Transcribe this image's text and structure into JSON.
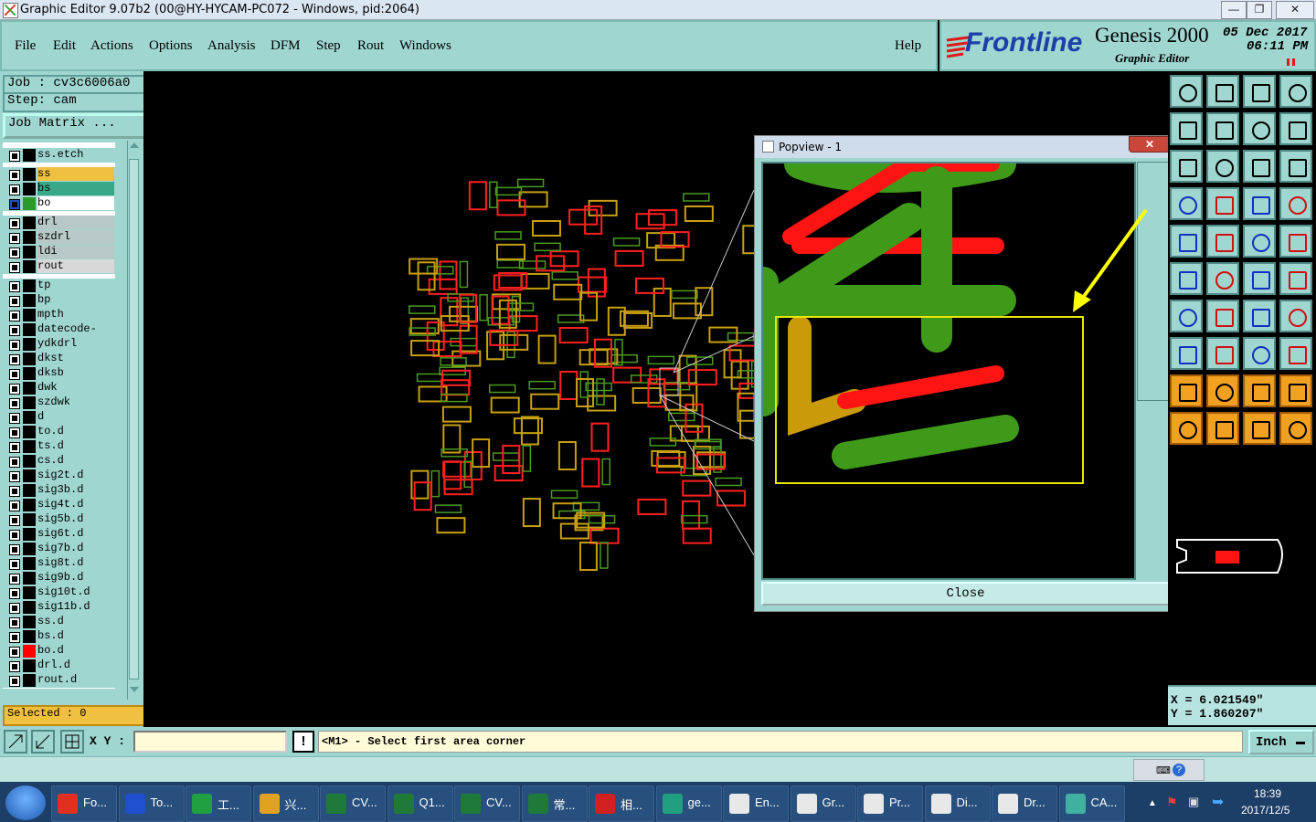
{
  "window": {
    "title": "Graphic Editor 9.07b2 (00@HY-HYCAM-PC072 - Windows, pid:2064)"
  },
  "menu": [
    "File",
    "Edit",
    "Actions",
    "Options",
    "Analysis",
    "DFM",
    "Step",
    "Rout",
    "Windows"
  ],
  "help": "Help",
  "brand": {
    "logo": "Frontline",
    "product": "Genesis 2000",
    "subtitle": "Graphic Editor",
    "date": "05 Dec 2017",
    "time": "06:11 PM"
  },
  "job": {
    "job_label": "Job : cv3c6006a0",
    "step_label": "Step: cam",
    "matrix_button": "Job Matrix ..."
  },
  "layers": [
    {
      "name": "ss.etch",
      "color": "#000000",
      "sep": false
    },
    {
      "name": "ss",
      "color": "#000000",
      "bg": "#f0c040",
      "sep": true
    },
    {
      "name": "bs",
      "color": "#000000",
      "bg": "#3aa888",
      "sep": false
    },
    {
      "name": "bo",
      "color": "#2a9a2a",
      "bg": "#ffffff",
      "sep": false,
      "active": true
    },
    {
      "name": "drl",
      "color": "#000000",
      "bg": "#b8c8c8",
      "sep": true
    },
    {
      "name": "szdrl",
      "color": "#000000",
      "bg": "#b8c8c8",
      "sep": false
    },
    {
      "name": "ldi",
      "color": "#000000",
      "bg": "#b8c8c8",
      "sep": false
    },
    {
      "name": "rout",
      "color": "#000000",
      "bg": "#d8d8d8",
      "sep": false
    },
    {
      "name": "tp",
      "color": "#000000",
      "sep": true
    },
    {
      "name": "bp",
      "color": "#000000",
      "sep": false
    },
    {
      "name": "mpth",
      "color": "#000000",
      "sep": false
    },
    {
      "name": "datecode-pbe",
      "color": "#000000",
      "sep": false
    },
    {
      "name": "ydkdrl",
      "color": "#000000",
      "sep": false
    },
    {
      "name": "dkst",
      "color": "#000000",
      "sep": false
    },
    {
      "name": "dksb",
      "color": "#000000",
      "sep": false
    },
    {
      "name": "dwk",
      "color": "#000000",
      "sep": false
    },
    {
      "name": "szdwk",
      "color": "#000000",
      "sep": false
    },
    {
      "name": "d",
      "color": "#000000",
      "sep": false
    },
    {
      "name": "to.d",
      "color": "#000000",
      "sep": false
    },
    {
      "name": "ts.d",
      "color": "#000000",
      "sep": false
    },
    {
      "name": "cs.d",
      "color": "#000000",
      "sep": false
    },
    {
      "name": "sig2t.d",
      "color": "#000000",
      "sep": false
    },
    {
      "name": "sig3b.d",
      "color": "#000000",
      "sep": false
    },
    {
      "name": "sig4t.d",
      "color": "#000000",
      "sep": false
    },
    {
      "name": "sig5b.d",
      "color": "#000000",
      "sep": false
    },
    {
      "name": "sig6t.d",
      "color": "#000000",
      "sep": false
    },
    {
      "name": "sig7b.d",
      "color": "#000000",
      "sep": false
    },
    {
      "name": "sig8t.d",
      "color": "#000000",
      "sep": false
    },
    {
      "name": "sig9b.d",
      "color": "#000000",
      "sep": false
    },
    {
      "name": "sig10t.d",
      "color": "#000000",
      "sep": false
    },
    {
      "name": "sig11b.d",
      "color": "#000000",
      "sep": false
    },
    {
      "name": "ss.d",
      "color": "#000000",
      "sep": false
    },
    {
      "name": "bs.d",
      "color": "#000000",
      "sep": false
    },
    {
      "name": "bo.d",
      "color": "#ff0000",
      "sep": false
    },
    {
      "name": "drl.d",
      "color": "#000000",
      "sep": false
    },
    {
      "name": "rout.d",
      "color": "#000000",
      "sep": false
    }
  ],
  "selected": "Selected : 0",
  "popview": {
    "title": "Popview - 1",
    "close": "Close"
  },
  "coords": {
    "x": "X = 6.021549\"",
    "y": "Y = 1.860207\""
  },
  "command": {
    "xy_label": "X Y :",
    "prompt": "<M1> - Select first area corner",
    "units": "Inch"
  },
  "taskbar": {
    "tasks": [
      {
        "label": "Fo...",
        "icon": "red-g-icon"
      },
      {
        "label": "To...",
        "icon": "floppy-icon"
      },
      {
        "label": "工...",
        "icon": "green-p-icon"
      },
      {
        "label": "兴...",
        "icon": "shell-icon"
      },
      {
        "label": "CV...",
        "icon": "excel-icon"
      },
      {
        "label": "Q1...",
        "icon": "excel-icon"
      },
      {
        "label": "CV...",
        "icon": "excel-icon"
      },
      {
        "label": "常...",
        "icon": "excel-icon"
      },
      {
        "label": "相...",
        "icon": "pdf-icon"
      },
      {
        "label": "ge...",
        "icon": "eye-icon"
      },
      {
        "label": "En...",
        "icon": "genesis-icon"
      },
      {
        "label": "Gr...",
        "icon": "genesis-icon"
      },
      {
        "label": "Pr...",
        "icon": "genesis-icon"
      },
      {
        "label": "Di...",
        "icon": "genesis-icon"
      },
      {
        "label": "Dr...",
        "icon": "genesis-icon"
      },
      {
        "label": "CA...",
        "icon": "cam-icon"
      }
    ],
    "time": "18:39",
    "date": "2017/12/5"
  }
}
